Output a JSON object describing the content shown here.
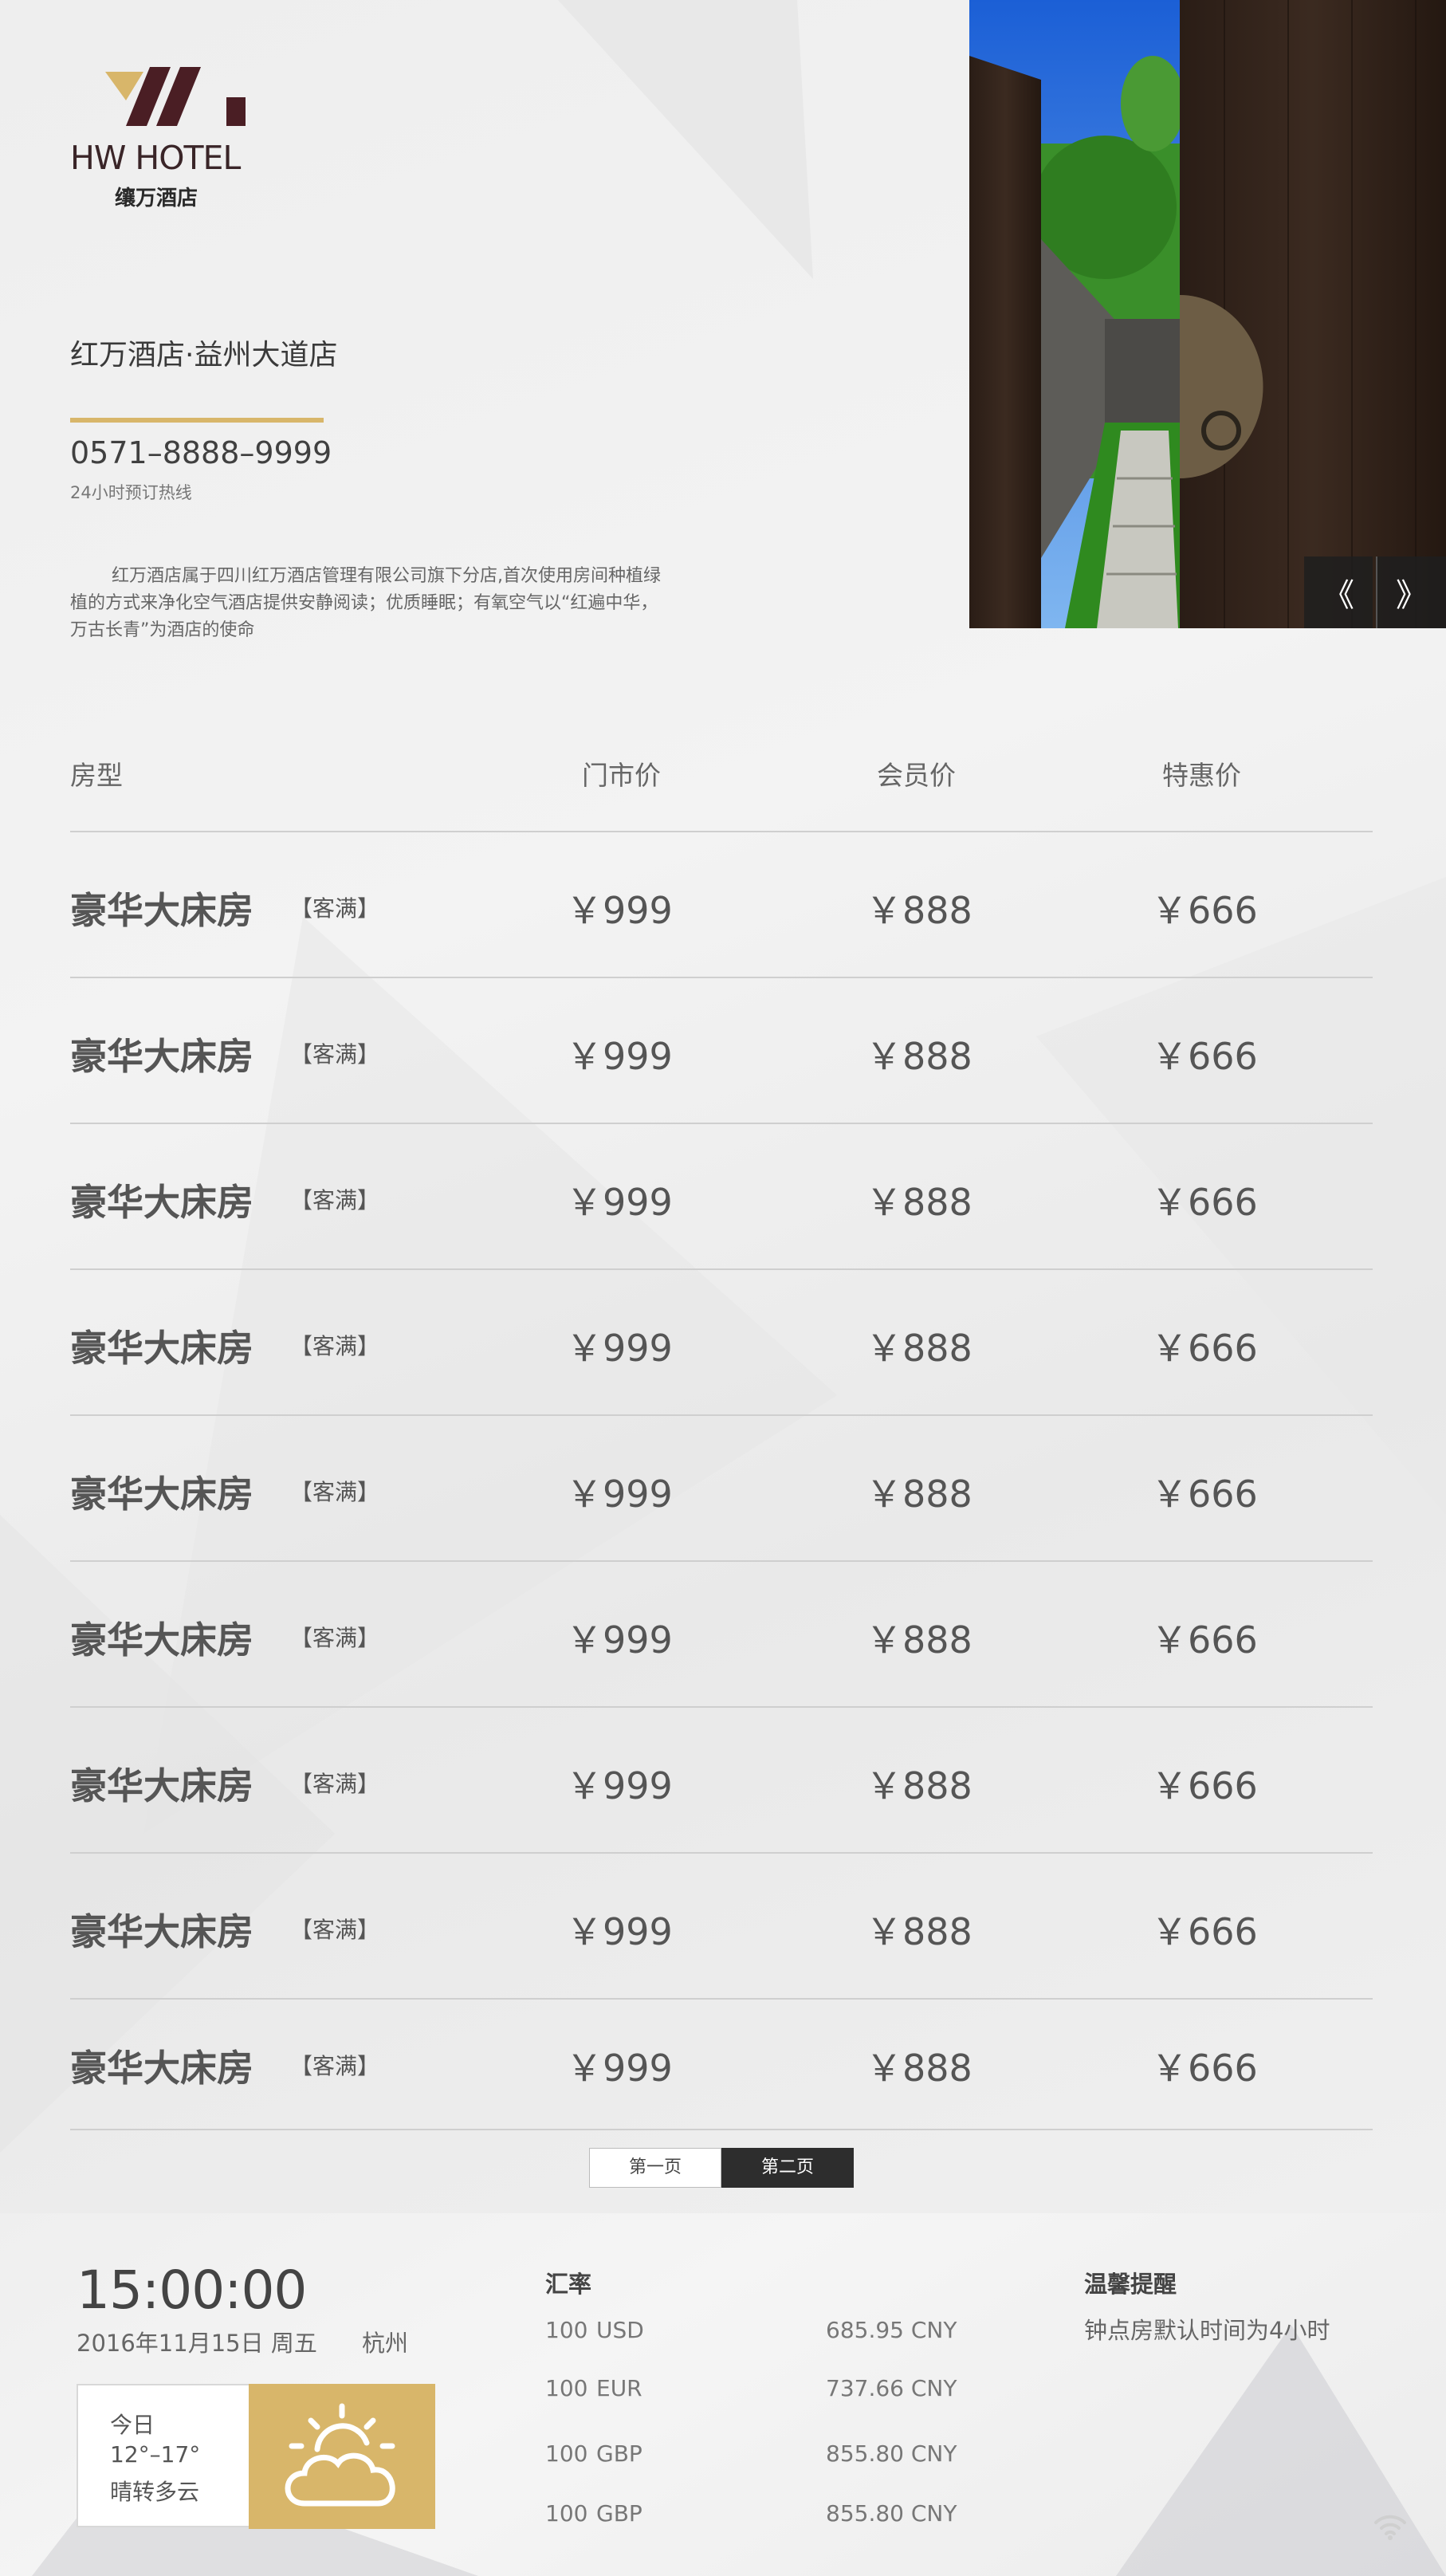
{
  "logo": {
    "brand": "HW HOTEL",
    "sub": "𬙋万酒店"
  },
  "hotel": {
    "name": "红万酒店·益州大道店",
    "phone": "0571–8888–9999",
    "hotline": "24小时预订热线",
    "description": "红万酒店属于四川红万酒店管理有限公司旗下分店,首次使用房间种植绿植的方式来净化空气酒店提供安静阅读；优质睡眠；有氧空气以“红遍中华，万古长青”为酒店的使命"
  },
  "carousel": {
    "prev": "《",
    "next": "》"
  },
  "table": {
    "headers": [
      "房型",
      "门市价",
      "会员价",
      "特惠价"
    ],
    "rows": [
      {
        "room": "豪华大床房",
        "tag": "【客满】",
        "retail": "￥999",
        "member": "￥888",
        "special": "￥666"
      },
      {
        "room": "豪华大床房",
        "tag": "【客满】",
        "retail": "￥999",
        "member": "￥888",
        "special": "￥666"
      },
      {
        "room": "豪华大床房",
        "tag": "【客满】",
        "retail": "￥999",
        "member": "￥888",
        "special": "￥666"
      },
      {
        "room": "豪华大床房",
        "tag": "【客满】",
        "retail": "￥999",
        "member": "￥888",
        "special": "￥666"
      },
      {
        "room": "豪华大床房",
        "tag": "【客满】",
        "retail": "￥999",
        "member": "￥888",
        "special": "￥666"
      },
      {
        "room": "豪华大床房",
        "tag": "【客满】",
        "retail": "￥999",
        "member": "￥888",
        "special": "￥666"
      },
      {
        "room": "豪华大床房",
        "tag": "【客满】",
        "retail": "￥999",
        "member": "￥888",
        "special": "￥666"
      },
      {
        "room": "豪华大床房",
        "tag": "【客满】",
        "retail": "￥999",
        "member": "￥888",
        "special": "￥666"
      },
      {
        "room": "豪华大床房",
        "tag": "【客满】",
        "retail": "￥999",
        "member": "￥888",
        "special": "￥666"
      }
    ]
  },
  "pager": {
    "page1": "第一页",
    "page2": "第二页",
    "active": 2
  },
  "info": {
    "time": "15:00:00",
    "date": "2016年11月15日  周五",
    "city": "杭州",
    "weather": {
      "today": "今日",
      "temp": "12°–17°",
      "desc": "晴转多云",
      "icon": "partly-cloudy-icon"
    },
    "fx": {
      "title": "汇率",
      "rows": [
        {
          "amount": "100",
          "currency": "USD",
          "value": "685.95  CNY"
        },
        {
          "amount": "100",
          "currency": "EUR",
          "value": "737.66  CNY"
        },
        {
          "amount": "100",
          "currency": "GBP",
          "value": "855.80 CNY"
        },
        {
          "amount": "100",
          "currency": "GBP",
          "value": "855.80 CNY"
        }
      ]
    },
    "tip": {
      "title": "温馨提醒",
      "text": "钟点房默认时间为4小时"
    }
  },
  "colors": {
    "gold": "#d8b66a",
    "maroon": "#4a1e24",
    "dark": "#2d2d2d"
  }
}
